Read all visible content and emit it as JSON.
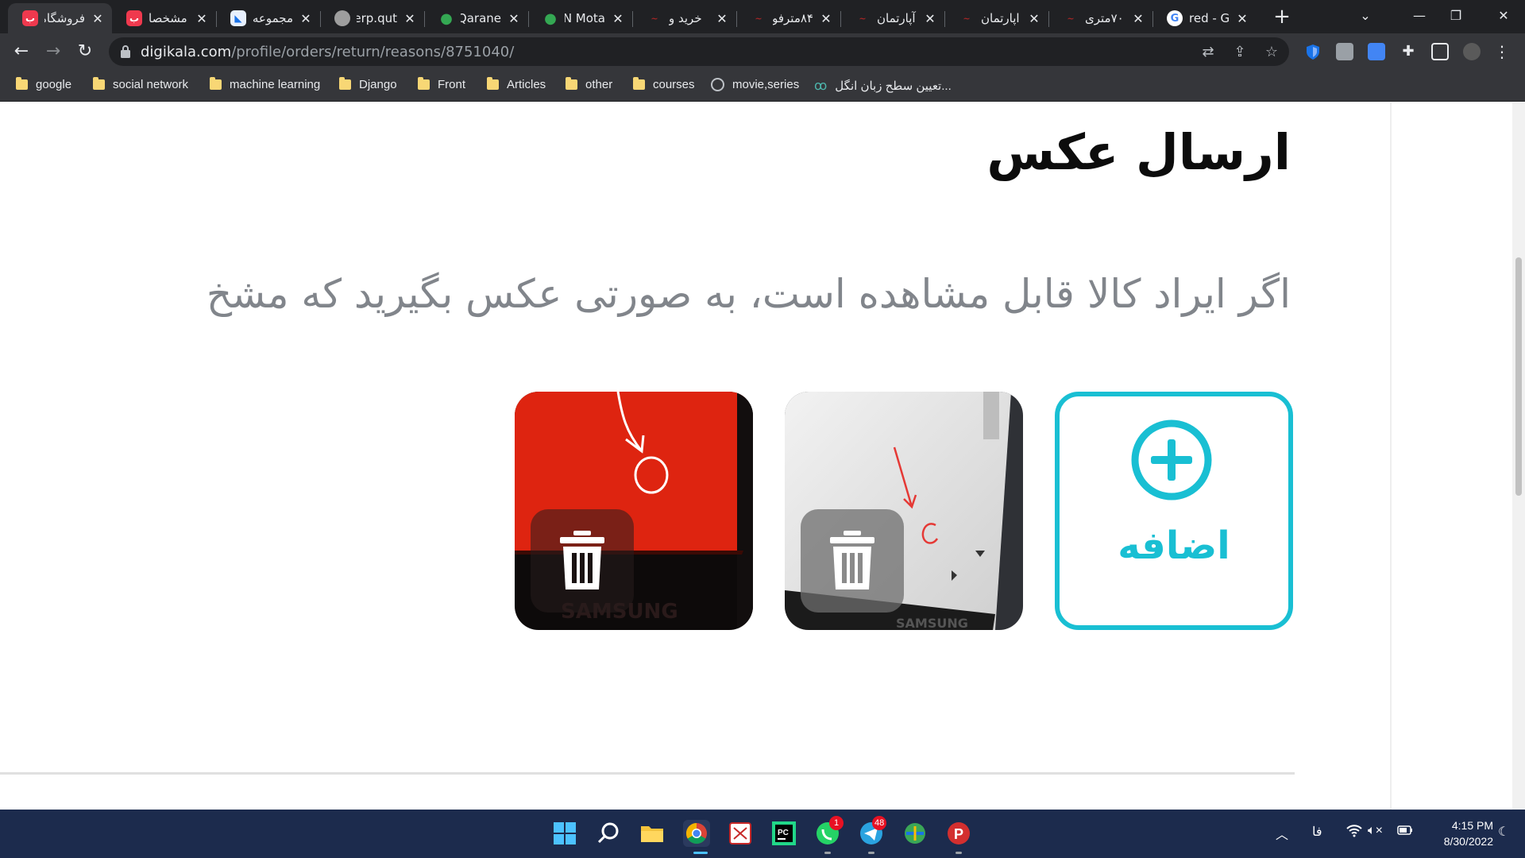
{
  "tabs": [
    {
      "title": "فروشگاه",
      "favicon": "digikala-icon",
      "color": "#ef394e",
      "active": true
    },
    {
      "title": "مشخصا",
      "favicon": "digikala-icon",
      "color": "#ef394e"
    },
    {
      "title": "مجموعه",
      "favicon": "blue-logo-icon",
      "color": "#4285f4"
    },
    {
      "title": "erp.qut.",
      "favicon": "circle-logo-icon",
      "color": "#9e9e9e"
    },
    {
      "title": "Qarane",
      "favicon": "maps-pin-icon",
      "color": "#34a853"
    },
    {
      "title": "N Mota",
      "favicon": "maps-pin-icon",
      "color": "#34a853"
    },
    {
      "title": "خرید و",
      "favicon": "divar-icon",
      "color": "#a62626"
    },
    {
      "title": "۸۴مترفو",
      "favicon": "divar-icon",
      "color": "#a62626"
    },
    {
      "title": "آپارتمان",
      "favicon": "divar-icon",
      "color": "#a62626"
    },
    {
      "title": "اپارتمان",
      "favicon": "divar-icon",
      "color": "#a62626"
    },
    {
      "title": "۷۰متری",
      "favicon": "divar-icon",
      "color": "#a62626"
    },
    {
      "title": "red - Go",
      "favicon": "google-icon",
      "color": "#ffffff"
    }
  ],
  "toolbar": {
    "url_host": "digikala.com",
    "url_path": "/profile/orders/return/reasons/8751040/"
  },
  "bookmarks": [
    {
      "label": "google",
      "type": "folder"
    },
    {
      "label": "social network",
      "type": "folder"
    },
    {
      "label": "machine learning",
      "type": "folder"
    },
    {
      "label": "Django",
      "type": "folder"
    },
    {
      "label": "Front",
      "type": "folder"
    },
    {
      "label": "Articles",
      "type": "folder"
    },
    {
      "label": "other",
      "type": "folder"
    },
    {
      "label": "courses",
      "type": "folder"
    },
    {
      "label": "movie,series",
      "type": "globe"
    },
    {
      "label": "تعیین سطح زبان انگل...",
      "type": "link"
    }
  ],
  "page": {
    "title": "ارسال عکس",
    "description": "اگر ایراد کالا قابل مشاهده است، به صورتی عکس بگیرید که مشخ",
    "add_label": "اضافه",
    "photo_brand_text": "SAMSUNG"
  },
  "colors": {
    "accent": "#19bfd3",
    "title": "#0c0c0c",
    "description": "#81858b"
  },
  "taskbar": {
    "apps": [
      "windows-start-icon",
      "search-icon",
      "file-explorer-icon",
      "chrome-icon",
      "app-icon",
      "pycharm-icon",
      "whatsapp-icon",
      "telegram-icon",
      "internet-download-manager-icon",
      "psiphon-icon"
    ],
    "whatsapp_badge": "1",
    "telegram_badge": "48",
    "language": "فا",
    "time": "4:15 PM",
    "date": "8/30/2022"
  }
}
